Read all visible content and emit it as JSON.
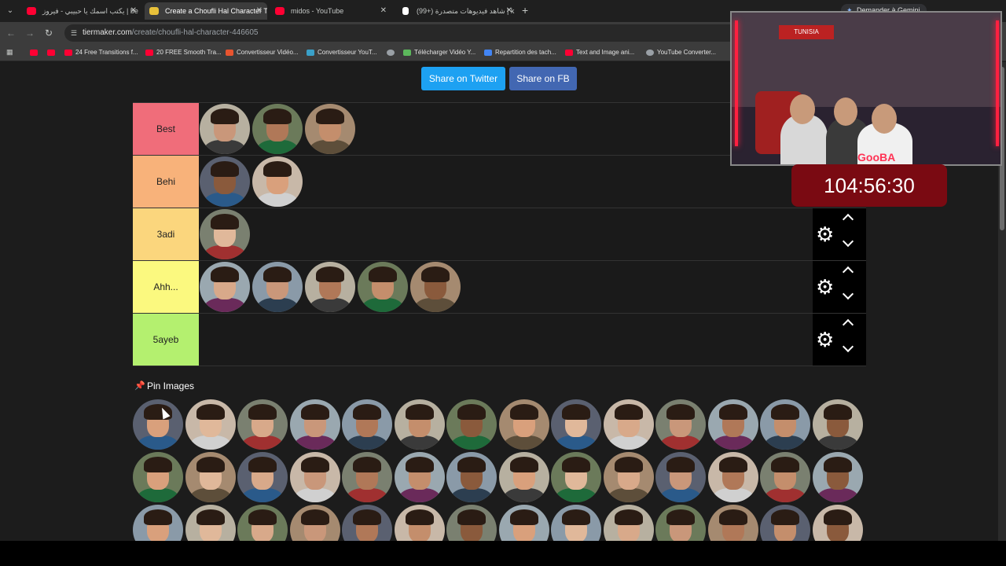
{
  "browser": {
    "tabs": [
      {
        "title": "يكتب اسمك يا حبيبي - فيروز | be",
        "icon_color": "#ff0033",
        "active": false
      },
      {
        "title": "Create a Choufli Hal Character T",
        "icon_color": "#e8c13a",
        "active": true
      },
      {
        "title": "midos - YouTube",
        "icon_color": "#ff0033",
        "active": false
      },
      {
        "title": "شاهد فيديوهات متصدرة (+99) | k",
        "icon_color": "#ffffff",
        "active": false
      }
    ],
    "new_tab_glyph": "+",
    "gemini_label": "Demander à Gemini",
    "url_host": "tiermaker.com",
    "url_path": "/create/choufli-hal-character-446605",
    "bookmarks": [
      {
        "label": "",
        "icon_color": "#ff0033"
      },
      {
        "label": "",
        "icon_color": "#ff0033"
      },
      {
        "label": "24 Free Transitions f...",
        "icon_color": "#ff0033"
      },
      {
        "label": "20 FREE Smooth Tra...",
        "icon_color": "#ff0033"
      },
      {
        "label": "Convertisseur Vidéo...",
        "icon_color": "#e8542f"
      },
      {
        "label": "Convertisseur YouT...",
        "icon_color": "#3aa0c8"
      },
      {
        "label": "",
        "icon_color": "#9aa0a6"
      },
      {
        "label": "Télécharger Vidéo Y...",
        "icon_color": "#5cb85c"
      },
      {
        "label": "Repartition des tach...",
        "icon_color": "#4285f4"
      },
      {
        "label": "Text and Image ani...",
        "icon_color": "#ff0033"
      },
      {
        "label": "YouTube Converter...",
        "icon_color": "#9aa0a6"
      }
    ]
  },
  "page": {
    "share_twitter": "Share on Twitter",
    "share_fb": "Share on FB",
    "tiers": [
      {
        "label": "Best",
        "color": "#f06d7a",
        "items": 3,
        "controls": false
      },
      {
        "label": "Behi",
        "color": "#f8b27a",
        "items": 2,
        "controls": false
      },
      {
        "label": "3adi",
        "color": "#fbd67d",
        "items": 1,
        "controls": true
      },
      {
        "label": "Ahh...",
        "color": "#fbf97f",
        "items": 5,
        "controls": true
      },
      {
        "label": "5ayeb",
        "color": "#b4f06f",
        "items": 0,
        "controls": true
      }
    ],
    "pin_images_label": "Pin Images",
    "pool_rows": 3,
    "pool_cols": 14
  },
  "stream": {
    "timer": "104:56:30",
    "flag_text": "TUNISIA",
    "logo_text": "GooBA"
  }
}
